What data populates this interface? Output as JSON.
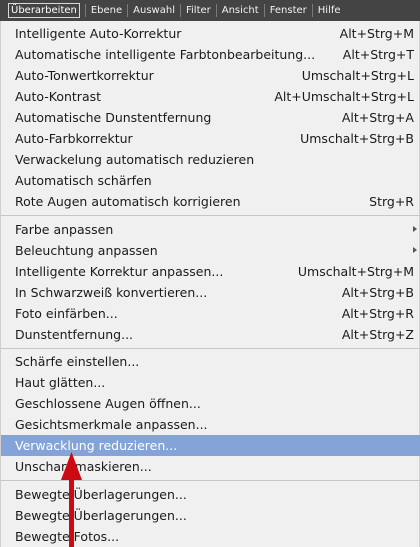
{
  "menubar": {
    "items": [
      {
        "label": "Überarbeiten"
      },
      {
        "label": "Ebene"
      },
      {
        "label": "Auswahl"
      },
      {
        "label": "Filter"
      },
      {
        "label": "Ansicht"
      },
      {
        "label": "Fenster"
      },
      {
        "label": "Hilfe"
      }
    ]
  },
  "menu": {
    "groups": [
      [
        {
          "label": "Intelligente Auto-Korrektur",
          "shortcut": "Alt+Strg+M"
        },
        {
          "label": "Automatische intelligente Farbtonbearbeitung...",
          "shortcut": "Alt+Strg+T"
        },
        {
          "label": "Auto-Tonwertkorrektur",
          "shortcut": "Umschalt+Strg+L"
        },
        {
          "label": "Auto-Kontrast",
          "shortcut": "Alt+Umschalt+Strg+L"
        },
        {
          "label": "Automatische Dunstentfernung",
          "shortcut": "Alt+Strg+A"
        },
        {
          "label": "Auto-Farbkorrektur",
          "shortcut": "Umschalt+Strg+B"
        },
        {
          "label": "Verwackelung automatisch reduzieren",
          "shortcut": ""
        },
        {
          "label": "Automatisch schärfen",
          "shortcut": ""
        },
        {
          "label": "Rote Augen automatisch korrigieren",
          "shortcut": "Strg+R"
        }
      ],
      [
        {
          "label": "Farbe anpassen",
          "shortcut": "",
          "submenu": true
        },
        {
          "label": "Beleuchtung anpassen",
          "shortcut": "",
          "submenu": true
        },
        {
          "label": "Intelligente Korrektur anpassen...",
          "shortcut": "Umschalt+Strg+M"
        },
        {
          "label": "In Schwarzweiß konvertieren...",
          "shortcut": "Alt+Strg+B"
        },
        {
          "label": "Foto einfärben...",
          "shortcut": "Alt+Strg+R"
        },
        {
          "label": "Dunstentfernung...",
          "shortcut": "Alt+Strg+Z"
        }
      ],
      [
        {
          "label": "Schärfe einstellen...",
          "shortcut": ""
        },
        {
          "label": "Haut glätten...",
          "shortcut": ""
        },
        {
          "label": "Geschlossene Augen öffnen...",
          "shortcut": ""
        },
        {
          "label": "Gesichtsmerkmale anpassen...",
          "shortcut": ""
        },
        {
          "label": "Verwacklung reduzieren...",
          "shortcut": "",
          "highlighted": true
        },
        {
          "label": "Unscharf maskieren...",
          "shortcut": ""
        }
      ],
      [
        {
          "label": "Bewegte Überlagerungen...",
          "shortcut": ""
        },
        {
          "label": "Bewegte Überlagerungen...",
          "shortcut": ""
        },
        {
          "label": "Bewegte Fotos...",
          "shortcut": ""
        }
      ]
    ]
  },
  "colors": {
    "menubar_bg": "#444444",
    "menu_bg": "#f0f0f0",
    "highlight_bg": "#84a3d6",
    "arrow": "#cc0a14"
  }
}
